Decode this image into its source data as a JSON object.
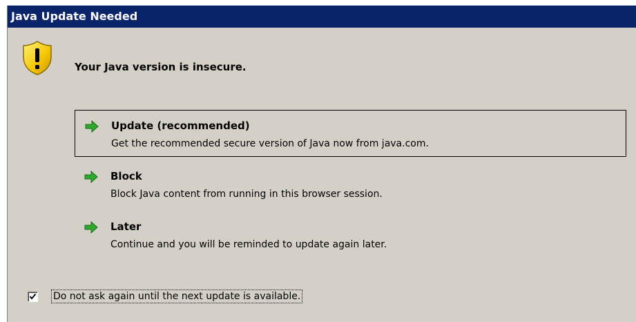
{
  "dialog": {
    "title": "Java Update Needed",
    "heading": "Your Java version is insecure.",
    "warning_icon": "warning-shield-icon"
  },
  "options": [
    {
      "title": "Update (recommended)",
      "description": "Get the recommended secure version of Java now from java.com.",
      "icon": "green-arrow-icon",
      "selected": true
    },
    {
      "title": "Block",
      "description": "Block Java content from running in this browser session.",
      "icon": "green-arrow-icon",
      "selected": false
    },
    {
      "title": "Later",
      "description": "Continue and you will be reminded to update again later.",
      "icon": "green-arrow-icon",
      "selected": false
    }
  ],
  "checkbox": {
    "label": "Do not ask again until the next update is available.",
    "checked": true
  },
  "colors": {
    "titlebar": "#0a246a",
    "dialog_background": "#d4d0c8",
    "arrow": "#2fa82f",
    "warning": "#f5c400"
  }
}
